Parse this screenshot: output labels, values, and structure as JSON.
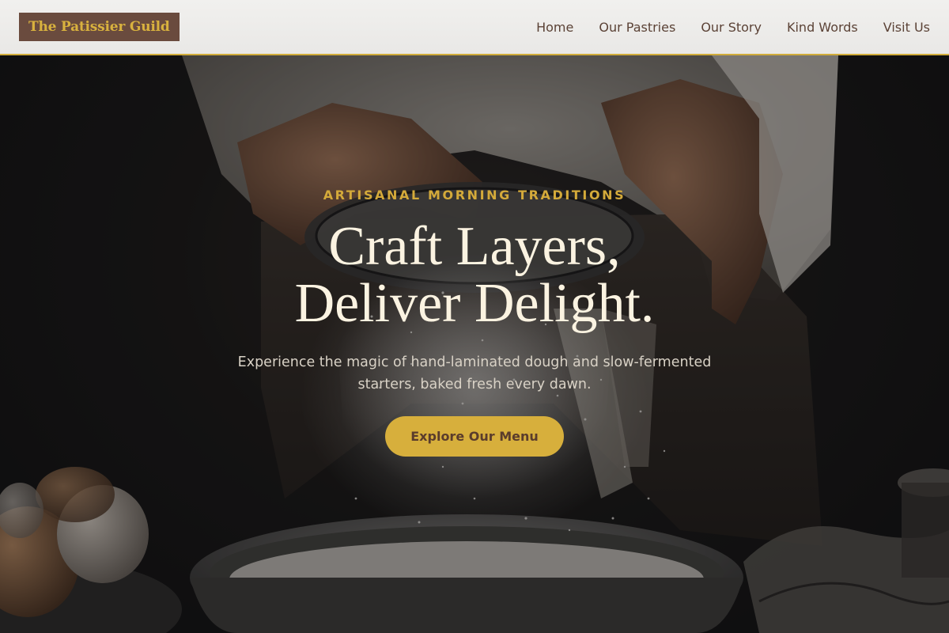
{
  "header": {
    "logo_text": "The Patissier Guild",
    "nav": [
      {
        "label": "Home"
      },
      {
        "label": "Our Pastries"
      },
      {
        "label": "Our Story"
      },
      {
        "label": "Kind Words"
      },
      {
        "label": "Visit Us"
      }
    ]
  },
  "hero": {
    "eyebrow": "ARTISANAL MORNING TRADITIONS",
    "headline_line1": "Craft Layers,",
    "headline_line2": "Deliver Delight.",
    "subtitle": "Experience the magic of hand-laminated dough and slow-fermented starters, baked fresh every dawn.",
    "cta_label": "Explore Our Menu"
  },
  "colors": {
    "accent_gold": "#d7af3c",
    "logo_bg": "#6a4b3e",
    "nav_text": "#5b4236",
    "headline": "#fbf3e1",
    "hero_bg": "#141416"
  }
}
